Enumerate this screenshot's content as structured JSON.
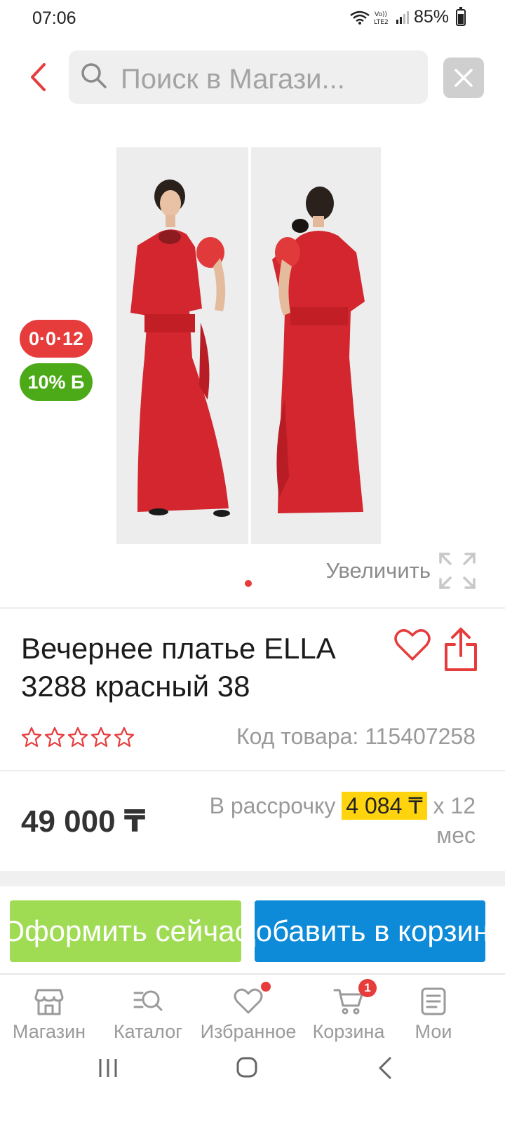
{
  "status_bar": {
    "time": "07:06",
    "battery": "85%"
  },
  "header": {
    "search_placeholder": "Поиск в Магази..."
  },
  "gallery": {
    "badge_installment": "0·0·12",
    "badge_bonus": "10% Б",
    "zoom_label": "Увеличить",
    "pages": 1,
    "current_page": 1
  },
  "product": {
    "title": "Вечернее платье ELLA 3288 красный 38",
    "rating_stars": 0,
    "rating_max": 5,
    "sku": "Код товара: 115407258",
    "price": "49 000 ₸",
    "installment_prefix": "В рассрочку",
    "installment_amount": "4 084 ₸",
    "installment_suffix": "х 12 мес"
  },
  "actions": {
    "checkout_label": "Оформить сейчас",
    "add_to_cart_label": "Добавить в корзину"
  },
  "bottom_nav": {
    "items": [
      {
        "label": "Магазин",
        "icon": "store-icon"
      },
      {
        "label": "Каталог",
        "icon": "catalog-search-icon"
      },
      {
        "label": "Избранное",
        "icon": "heart-icon"
      },
      {
        "label": "Корзина",
        "icon": "cart-icon",
        "badge": "1"
      },
      {
        "label": "Мои",
        "icon": "orders-icon"
      }
    ]
  },
  "colors": {
    "accent_red": "#e63c3c",
    "checkout_green": "#9fdc54",
    "add_cart_blue": "#0d8ad8",
    "price_highlight": "#ffd40f",
    "bonus_green": "#4caa18"
  }
}
